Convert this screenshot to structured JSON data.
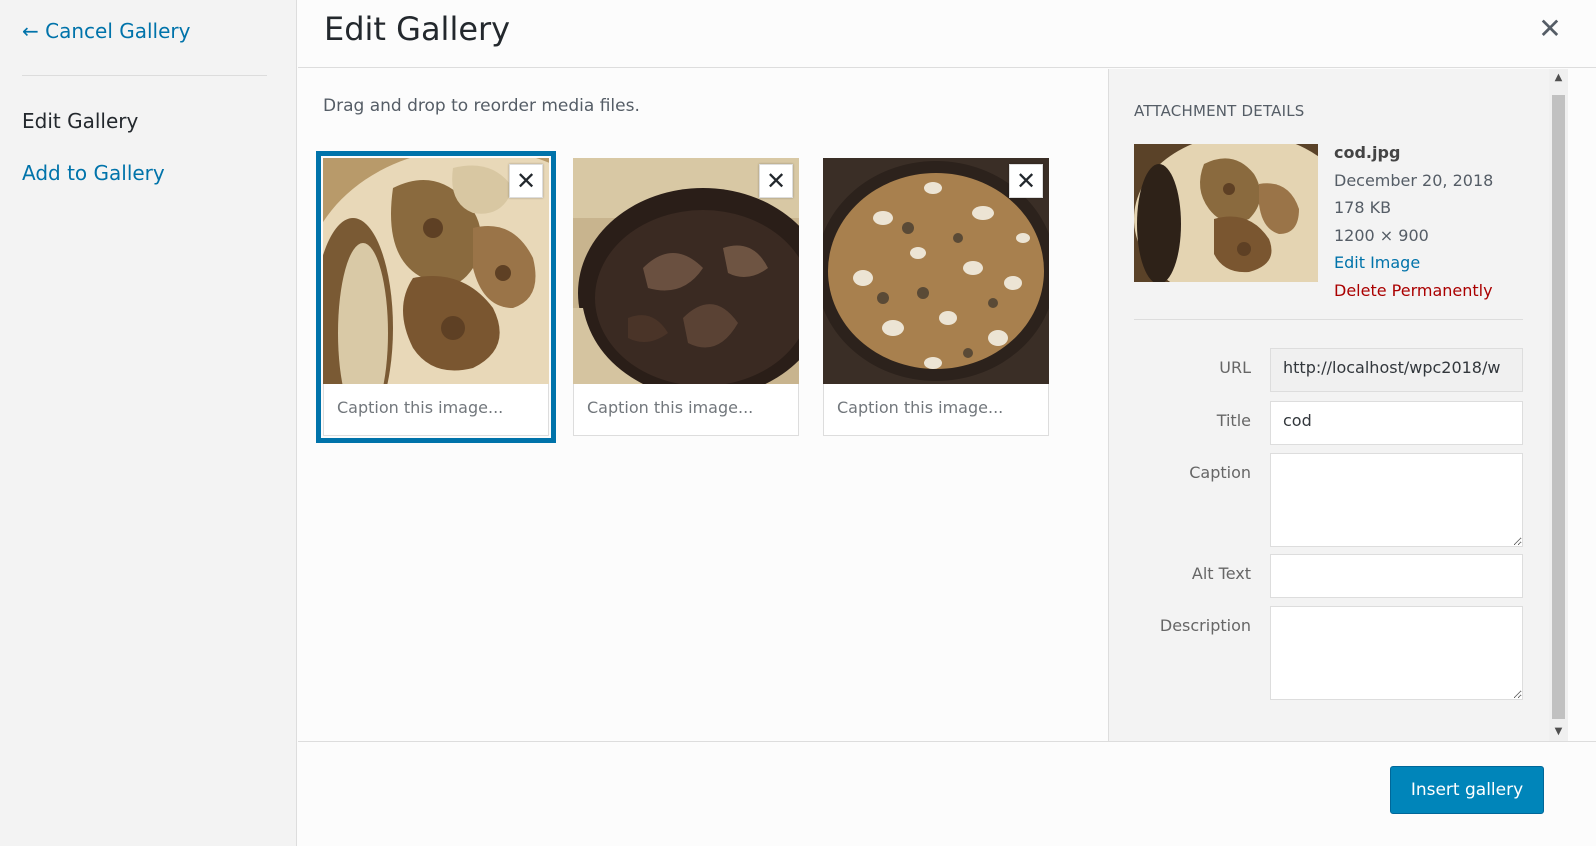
{
  "menu": {
    "cancel_label": "← Cancel Gallery",
    "current_label": "Edit Gallery",
    "add_label": "Add to Gallery"
  },
  "title": "Edit Gallery",
  "close_glyph": "✕",
  "instructions": "Drag and drop to reorder media files.",
  "attachments": [
    {
      "caption_placeholder": "Caption this image...",
      "remove_glyph": "✕",
      "image": "chicken-plate",
      "selected": true
    },
    {
      "caption_placeholder": "Caption this image...",
      "remove_glyph": "✕",
      "image": "mussels-pot",
      "selected": false
    },
    {
      "caption_placeholder": "Caption this image...",
      "remove_glyph": "✕",
      "image": "paella-pan",
      "selected": false
    }
  ],
  "details": {
    "heading": "ATTACHMENT DETAILS",
    "filename": "cod.jpg",
    "date": "December 20, 2018",
    "size": "178 KB",
    "dimensions": "1200 × 900",
    "edit_link": "Edit Image",
    "delete_link": "Delete Permanently"
  },
  "settings": {
    "url_label": "URL",
    "url_value": "http://localhost/wpc2018/w",
    "title_label": "Title",
    "title_value": "cod",
    "caption_label": "Caption",
    "caption_value": "",
    "alt_label": "Alt Text",
    "alt_value": "",
    "description_label": "Description",
    "description_value": ""
  },
  "toolbar": {
    "insert_label": "Insert gallery"
  },
  "colors": {
    "accent": "#0073aa",
    "button": "#0085ba",
    "delete": "#aa0000"
  }
}
